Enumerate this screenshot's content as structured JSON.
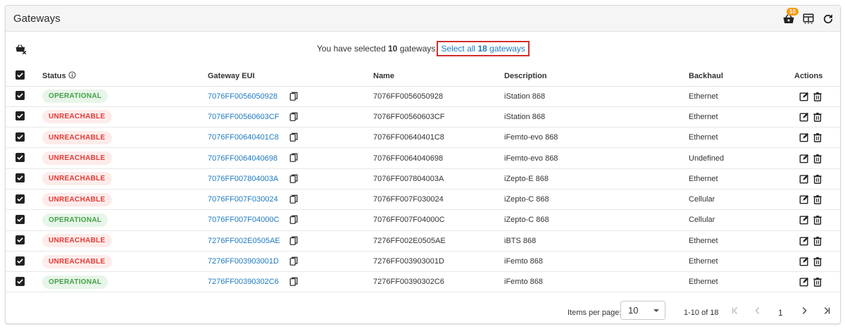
{
  "header": {
    "title": "Gateways",
    "basket_count": "10"
  },
  "selection": {
    "prefix": "You have selected",
    "selected_count": "10",
    "suffix": "gateways",
    "select_all_prefix": "Select all",
    "select_all_count": "18",
    "select_all_suffix": "gateways"
  },
  "columns": {
    "status": "Status",
    "gateway_eui": "Gateway EUI",
    "name": "Name",
    "description": "Description",
    "backhaul": "Backhaul",
    "actions": "Actions"
  },
  "rows": [
    {
      "status": "OPERATIONAL",
      "status_type": "op",
      "eui": "7076FF0056050928",
      "name": "7076FF0056050928",
      "description": "iStation 868",
      "backhaul": "Ethernet"
    },
    {
      "status": "UNREACHABLE",
      "status_type": "un",
      "eui": "7076FF00560603CF",
      "name": "7076FF00560603CF",
      "description": "iStation 868",
      "backhaul": "Ethernet"
    },
    {
      "status": "UNREACHABLE",
      "status_type": "un",
      "eui": "7076FF00640401C8",
      "name": "7076FF00640401C8",
      "description": "iFemto-evo 868",
      "backhaul": "Ethernet"
    },
    {
      "status": "UNREACHABLE",
      "status_type": "un",
      "eui": "7076FF0064040698",
      "name": "7076FF0064040698",
      "description": "iFemto-evo 868",
      "backhaul": "Undefined"
    },
    {
      "status": "UNREACHABLE",
      "status_type": "un",
      "eui": "7076FF007804003A",
      "name": "7076FF007804003A",
      "description": "iZepto-E 868",
      "backhaul": "Ethernet"
    },
    {
      "status": "UNREACHABLE",
      "status_type": "un",
      "eui": "7076FF007F030024",
      "name": "7076FF007F030024",
      "description": "iZepto-C 868",
      "backhaul": "Cellular"
    },
    {
      "status": "OPERATIONAL",
      "status_type": "op",
      "eui": "7076FF007F04000C",
      "name": "7076FF007F04000C",
      "description": "iZepto-C 868",
      "backhaul": "Cellular"
    },
    {
      "status": "UNREACHABLE",
      "status_type": "un",
      "eui": "7276FF002E0505AE",
      "name": "7276FF002E0505AE",
      "description": "iBTS 868",
      "backhaul": "Ethernet"
    },
    {
      "status": "UNREACHABLE",
      "status_type": "un",
      "eui": "7276FF003903001D",
      "name": "7276FF003903001D",
      "description": "iFemto 868",
      "backhaul": "Ethernet"
    },
    {
      "status": "OPERATIONAL",
      "status_type": "op",
      "eui": "7276FF00390302C6",
      "name": "7276FF00390302C6",
      "description": "iFemto 868",
      "backhaul": "Ethernet"
    }
  ],
  "footer": {
    "items_per_page_label": "Items per page:",
    "items_per_page": "10",
    "range": "1-10 of 18",
    "current_page": "1"
  },
  "colors": {
    "link": "#1e7ac2",
    "operational": "#43a047",
    "unreachable": "#e53935",
    "highlight_border": "#d32f2f",
    "badge": "#f39c12"
  },
  "icons": {
    "basket": "shopping-basket-icon",
    "columns": "table-columns-icon",
    "refresh": "refresh-icon",
    "bulk_delete": "basket-remove-icon",
    "copy": "copy-icon",
    "edit": "edit-icon",
    "delete": "trash-icon",
    "info": "info-icon"
  }
}
